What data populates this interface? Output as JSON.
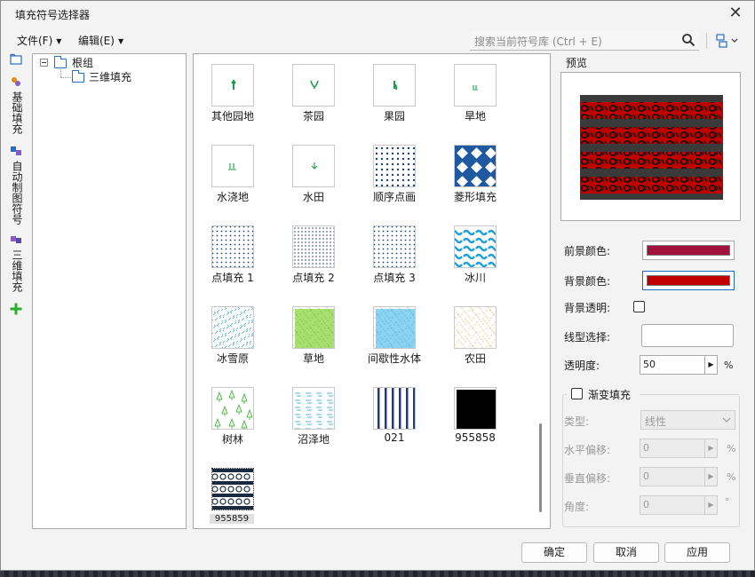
{
  "window": {
    "title": "填充符号选择器"
  },
  "menu": {
    "file": "文件(F)",
    "edit": "编辑(E)"
  },
  "search": {
    "placeholder": "搜索当前符号库 (Ctrl + E)"
  },
  "side_tabs": [
    "基础填充",
    "自动制图符号",
    "三维填充"
  ],
  "tree": {
    "root": "根组",
    "child": "三维填充"
  },
  "symbols": [
    {
      "label": "其他园地",
      "pattern": "sprout"
    },
    {
      "label": "茶园",
      "pattern": "tea"
    },
    {
      "label": "果园",
      "pattern": "fruit"
    },
    {
      "label": "旱地",
      "pattern": "dry"
    },
    {
      "label": "水浇地",
      "pattern": "irrigated"
    },
    {
      "label": "水田",
      "pattern": "paddy"
    },
    {
      "label": "顺序点画",
      "pattern": "seq-dots"
    },
    {
      "label": "菱形填充",
      "pattern": "diamond"
    },
    {
      "label": "点填充 1",
      "pattern": "dots1"
    },
    {
      "label": "点填充 2",
      "pattern": "dots2"
    },
    {
      "label": "点填充 3",
      "pattern": "dots3"
    },
    {
      "label": "冰川",
      "pattern": "glacier"
    },
    {
      "label": "冰雪原",
      "pattern": "snowfield"
    },
    {
      "label": "草地",
      "pattern": "grass"
    },
    {
      "label": "间歇性水体",
      "pattern": "water"
    },
    {
      "label": "农田",
      "pattern": "farmland"
    },
    {
      "label": "树林",
      "pattern": "forest"
    },
    {
      "label": "沼泽地",
      "pattern": "swamp"
    },
    {
      "label": "021",
      "pattern": "stripes"
    },
    {
      "label": "955858",
      "pattern": "black"
    },
    {
      "label": "955859",
      "pattern": "chain"
    }
  ],
  "preview": {
    "label": "预览"
  },
  "props": {
    "fg_label": "前景颜色:",
    "fg_color": "#a0113c",
    "bg_label": "背景颜色:",
    "bg_color": "#c00000",
    "bg_transparent_label": "背景透明:",
    "line_type_label": "线型选择:",
    "opacity_label": "透明度:",
    "opacity_value": "50",
    "opacity_unit": "%"
  },
  "gradient": {
    "title": "渐变填充",
    "type_label": "类型:",
    "type_value": "线性",
    "h_offset_label": "水平偏移:",
    "h_offset_value": "0",
    "v_offset_label": "垂直偏移:",
    "v_offset_value": "0",
    "angle_label": "角度:",
    "angle_value": "0",
    "percent": "%",
    "degree": "°"
  },
  "buttons": {
    "ok": "确定",
    "cancel": "取消",
    "apply": "应用"
  }
}
